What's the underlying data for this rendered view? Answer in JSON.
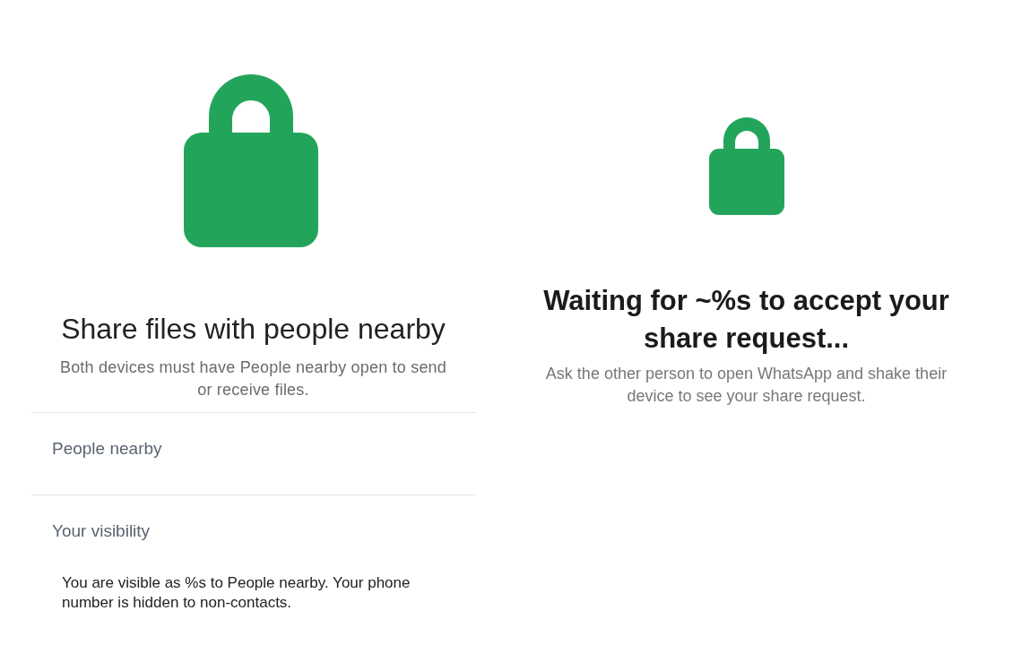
{
  "share_screen": {
    "title": "Share files with people nearby",
    "description": "Both devices must have People nearby open to send or receive files.",
    "sections": [
      {
        "label": "People nearby"
      },
      {
        "label": "Your visibility",
        "text": "You are visible as %s to People nearby. Your phone number is hidden to non-contacts."
      }
    ]
  },
  "waiting_screen": {
    "title": "Waiting for ~%s to accept your share request...",
    "description": "Ask the other person to open WhatsApp and shake their device to see your share request."
  }
}
